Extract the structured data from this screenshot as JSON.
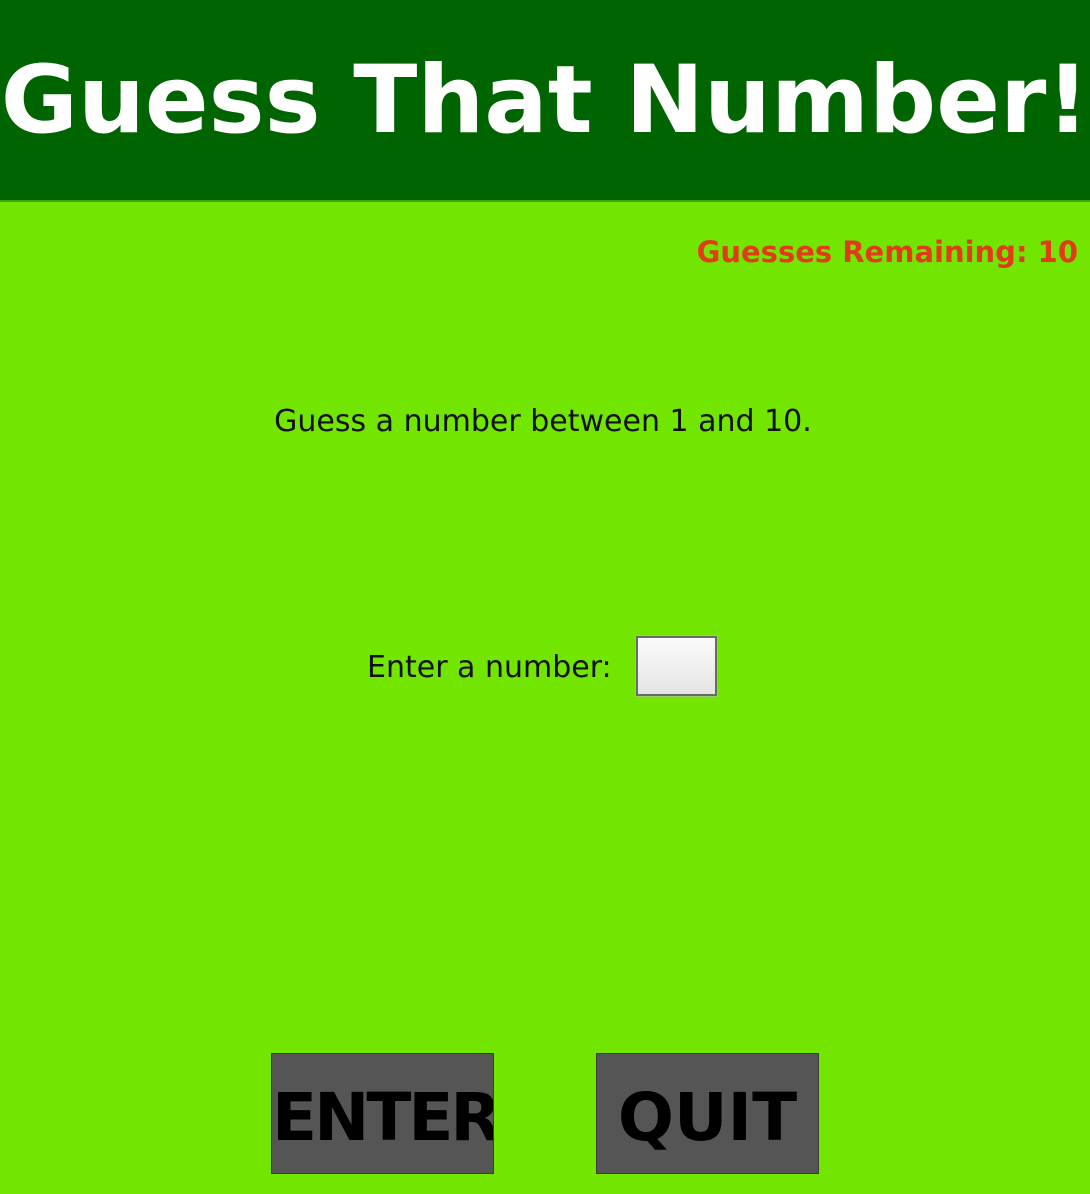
{
  "app": {
    "title": "Guess That Number!"
  },
  "status": {
    "guesses_remaining": "Guesses Remaining: 10"
  },
  "game": {
    "prompt": "Guess a number between 1 and 10.",
    "input_label": "Enter a number:",
    "input_value": ""
  },
  "buttons": {
    "enter_label": "ENTER",
    "quit_label": "QUIT"
  },
  "colors": {
    "header_background": "#006400",
    "page_background": "#72e600",
    "status_text": "#e23b1a",
    "button_background": "#555555"
  }
}
